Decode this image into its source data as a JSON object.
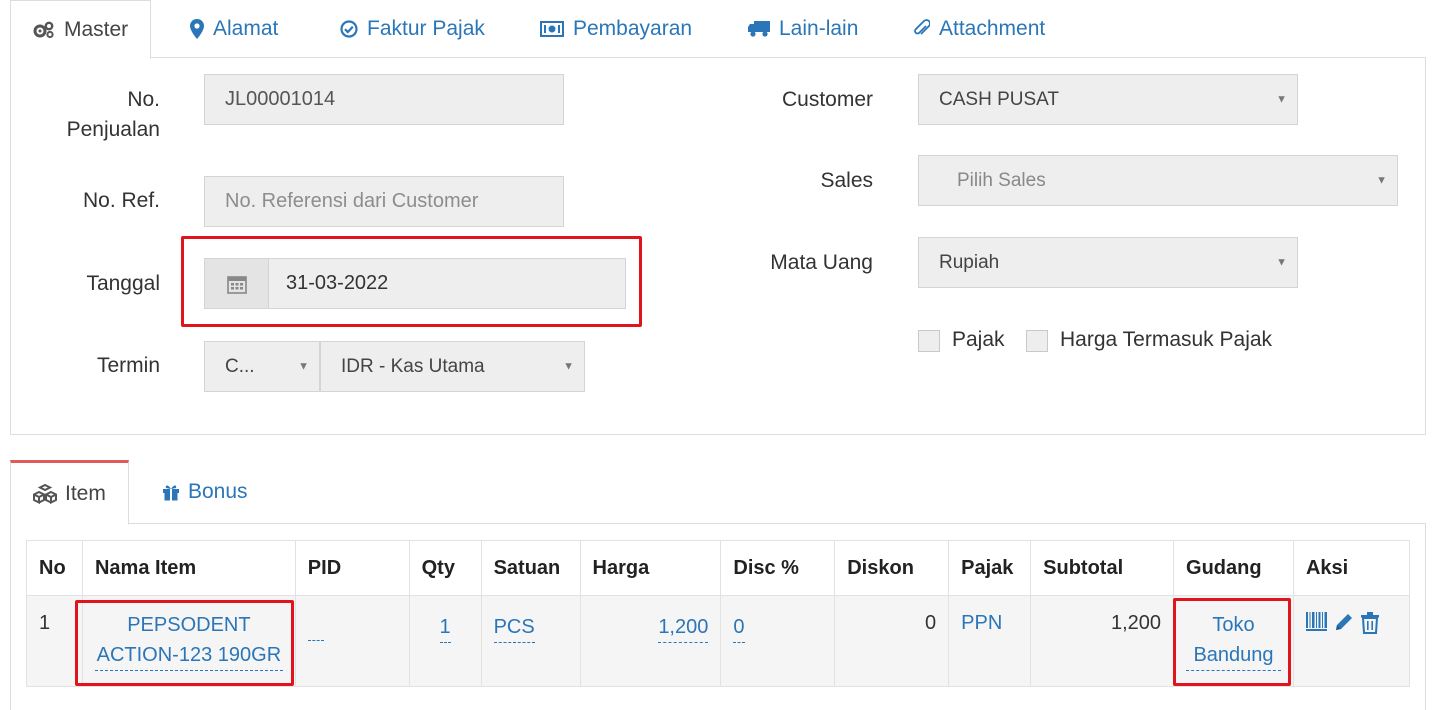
{
  "tabs": [
    {
      "label": "Master",
      "icon": "gears-icon"
    },
    {
      "label": "Alamat",
      "icon": "map-marker-icon"
    },
    {
      "label": "Faktur Pajak",
      "icon": "check-circle-icon"
    },
    {
      "label": "Pembayaran",
      "icon": "money-icon"
    },
    {
      "label": "Lain-lain",
      "icon": "truck-icon"
    },
    {
      "label": "Attachment",
      "icon": "paperclip-icon"
    }
  ],
  "form": {
    "no_penjualan_label": "No. Penjualan",
    "no_penjualan_value": "JL00001014",
    "no_ref_label": "No. Ref.",
    "no_ref_placeholder": "No. Referensi dari Customer",
    "tanggal_label": "Tanggal",
    "tanggal_value": "31-03-2022",
    "termin_label": "Termin",
    "termin_value": "C...",
    "kas_value": "IDR - Kas Utama",
    "customer_label": "Customer",
    "customer_value": "CASH PUSAT",
    "sales_label": "Sales",
    "sales_placeholder": "Pilih Sales",
    "mata_uang_label": "Mata Uang",
    "mata_uang_value": "Rupiah",
    "pajak_label": "Pajak",
    "harga_termasuk_pajak_label": "Harga Termasuk Pajak"
  },
  "subtabs": [
    {
      "label": "Item",
      "icon": "cubes-icon"
    },
    {
      "label": "Bonus",
      "icon": "gift-icon"
    }
  ],
  "table": {
    "headers": [
      "No",
      "Nama Item",
      "PID",
      "Qty",
      "Satuan",
      "Harga",
      "Disc %",
      "Diskon",
      "Pajak",
      "Subtotal",
      "Gudang",
      "Aksi"
    ],
    "rows": [
      {
        "no": "1",
        "nama_item": "PEPSODENT ACTION-123 190GR",
        "pid": "",
        "qty": "1",
        "satuan": "PCS",
        "harga": "1,200",
        "disc": "0",
        "diskon": "0",
        "pajak": "PPN",
        "subtotal": "1,200",
        "gudang": "Toko Bandung"
      }
    ]
  },
  "colors": {
    "accent": "#2a76b8",
    "highlight": "#e0141d",
    "active_tab_top": "#e25b5b"
  }
}
